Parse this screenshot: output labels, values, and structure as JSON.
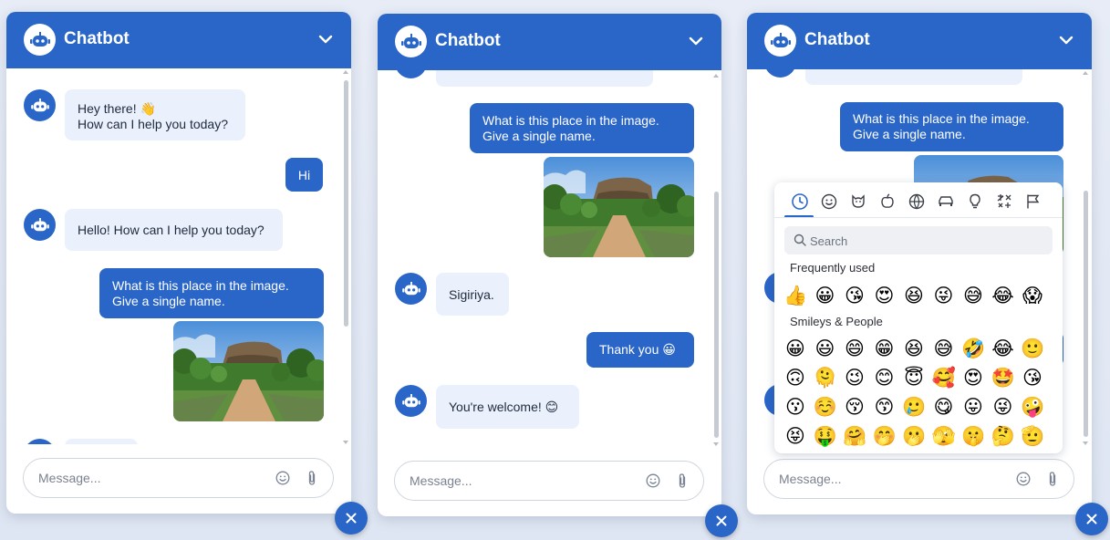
{
  "colors": {
    "brand": "#2a66c8",
    "bot_bubble": "#eaf1fd",
    "page_bg": "#e3e9f4"
  },
  "panels": [
    {
      "title": "Chatbot",
      "messages": {
        "bot1_line1": "Hey there! 👋",
        "bot1_line2": "How can I help you today?",
        "user1": "Hi",
        "bot2": "Hello! How can I help you today?",
        "user2_line1": "What is this place in the image.",
        "user2_line2": "Give a single name."
      },
      "placeholder": "Message..."
    },
    {
      "title": "Chatbot",
      "messages": {
        "user1_line1": "What is this place in the image.",
        "user1_line2": "Give a single name.",
        "bot1": "Sigiriya.",
        "user2": "Thank you 😀",
        "bot2": "You're welcome! 😊"
      },
      "placeholder": "Message..."
    },
    {
      "title": "Chatbot",
      "messages": {
        "user1_line1": "What is this place in the image.",
        "user1_line2": "Give a single name."
      },
      "placeholder": "Message..."
    }
  ],
  "emoji_picker": {
    "search_placeholder": "Search",
    "categories": [
      "clock-icon",
      "smiley-icon",
      "animal-icon",
      "food-icon",
      "globe-icon",
      "car-icon",
      "lightbulb-icon",
      "symbols-icon",
      "flag-icon"
    ],
    "frequently_used_label": "Frequently used",
    "frequently_used": [
      "👍",
      "😀",
      "😘",
      "😍",
      "😆",
      "😜",
      "😅",
      "😂",
      "😱"
    ],
    "smileys_label": "Smileys & People",
    "smileys": [
      "😀",
      "😃",
      "😄",
      "😁",
      "😆",
      "😅",
      "🤣",
      "😂",
      "🙂",
      "🙃",
      "🫠",
      "😉",
      "😊",
      "😇",
      "🥰",
      "😍",
      "🤩",
      "😘",
      "😗",
      "☺️",
      "😚",
      "😙",
      "🥲",
      "😋",
      "😛",
      "😜",
      "🤪",
      "😝",
      "🤑",
      "🤗",
      "🤭",
      "🫢",
      "🫣",
      "🤫",
      "🤔",
      "🫡"
    ]
  }
}
